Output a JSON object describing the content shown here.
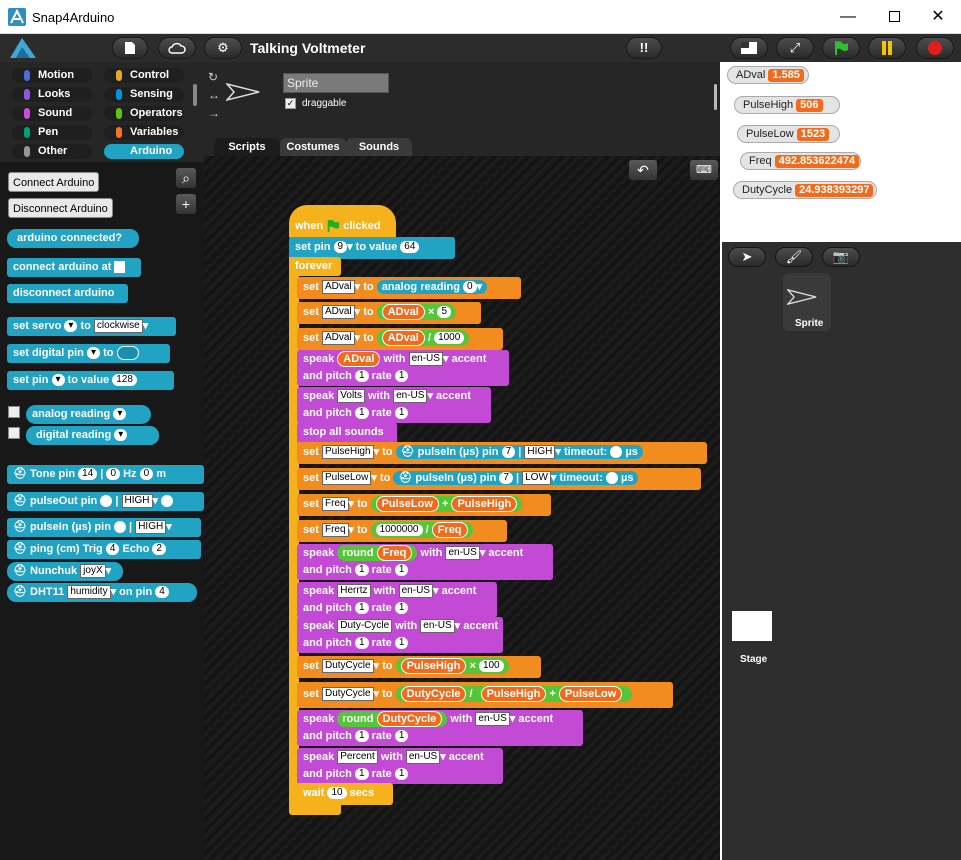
{
  "window": {
    "title": "Snap4Arduino"
  },
  "project": {
    "title": "Talking Voltmeter"
  },
  "categories": [
    {
      "label": "Motion",
      "color": "#4a6cd4"
    },
    {
      "label": "Control",
      "color": "#e6a822"
    },
    {
      "label": "Looks",
      "color": "#8f56e3"
    },
    {
      "label": "Sensing",
      "color": "#0494dc"
    },
    {
      "label": "Sound",
      "color": "#cf4ad9"
    },
    {
      "label": "Operators",
      "color": "#62c213"
    },
    {
      "label": "Pen",
      "color": "#00a178"
    },
    {
      "label": "Variables",
      "color": "#f3761d"
    },
    {
      "label": "Other",
      "color": "#969696"
    },
    {
      "label": "Arduino",
      "color": "#21a3c4"
    }
  ],
  "palette": {
    "connect": "Connect Arduino",
    "disconnect": "Disconnect Arduino",
    "arduino_connected": "arduino connected?",
    "connect_at": "connect arduino at",
    "disconnect_block": "disconnect arduino",
    "set_servo": "set servo",
    "to": "to",
    "clockwise": "clockwise",
    "set_digital_pin": "set digital pin",
    "set_pin": "set pin",
    "to_value": "to value",
    "v128": "128",
    "analog_reading": "analog reading",
    "digital_reading": "digital reading",
    "tone_pin": "Tone pin",
    "v14": "14",
    "bar": "|",
    "v0": "0",
    "hz": "Hz",
    "tone_tail": "0 m",
    "pulseout_pin": "pulseOut pin",
    "high": "HIGH",
    "pulsein_pin": "pulseIn (µs) pin",
    "ping": "ping (cm) Trig",
    "v4": "4",
    "echo": "Echo",
    "v2": "2",
    "nunchuk": "Nunchuk",
    "joyx": "joyX",
    "dht11": "DHT11",
    "humidity": "humidity",
    "on_pin": "on pin",
    "v4b": "4"
  },
  "sprite": {
    "name": "Sprite",
    "draggable": "draggable"
  },
  "tabs": [
    "Scripts",
    "Costumes",
    "Sounds"
  ],
  "script": {
    "hat_when": "when",
    "hat_clicked": "clicked",
    "set_pin": "set pin",
    "pin9": "9",
    "to_value": "to value",
    "v64": "64",
    "forever": "forever",
    "set": "set",
    "to": "to",
    "advar": "ADval",
    "analog_reading": "analog reading",
    "a0": "0",
    "times": "×",
    "v5": "5",
    "div": "/",
    "v1000": "1000",
    "speak": "speak",
    "with": "with",
    "lang": "en-US",
    "accent": "accent",
    "and_pitch": "and pitch",
    "one": "1",
    "rate": "rate",
    "volts": "Volts",
    "stop_all_sounds": "stop all sounds",
    "pulsehigh": "PulseHigh",
    "pulselow": "PulseLow",
    "pulsein": "pulseIn (µs) pin",
    "pin7": "7",
    "bar": "|",
    "high": "HIGH",
    "low": "LOW",
    "timeout": "timeout:",
    "us": "µs",
    "freq": "Freq",
    "plus": "+",
    "v1000000": "1000000",
    "round": "round",
    "herrtz": "Herrtz",
    "dutycycle_txt": "Duty-Cycle",
    "dutycycle": "DutyCycle",
    "v100": "100",
    "percent": "Percent",
    "wait": "wait",
    "v10": "10",
    "secs": "secs"
  },
  "watchers": [
    {
      "name": "ADval",
      "value": "1.585"
    },
    {
      "name": "PulseHigh",
      "value": "506"
    },
    {
      "name": "PulseLow",
      "value": "1523"
    },
    {
      "name": "Freq",
      "value": "492.853622474"
    },
    {
      "name": "DutyCycle",
      "value": "24.938393297"
    }
  ],
  "corral": {
    "sprite_label": "Sprite",
    "stage_label": "Stage"
  }
}
